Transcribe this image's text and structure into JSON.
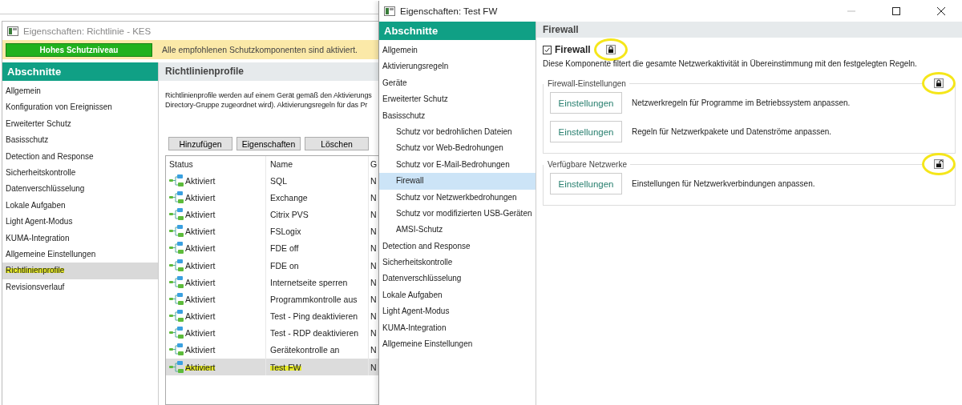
{
  "back_window": {
    "title": "Eigenschaften: Richtlinie - KES",
    "protection_level": {
      "label": "Hohes Schutzniveau",
      "message": "Alle empfohlenen Schutzkomponenten sind aktiviert."
    },
    "sidebar": {
      "header": "Abschnitte",
      "items": [
        {
          "label": "Allgemein",
          "selected": false,
          "highlighted": false
        },
        {
          "label": "Konfiguration von Ereignissen",
          "selected": false,
          "highlighted": false
        },
        {
          "label": "Erweiterter Schutz",
          "selected": false,
          "highlighted": false
        },
        {
          "label": "Basisschutz",
          "selected": false,
          "highlighted": false
        },
        {
          "label": "Detection and Response",
          "selected": false,
          "highlighted": false
        },
        {
          "label": "Sicherheitskontrolle",
          "selected": false,
          "highlighted": false
        },
        {
          "label": "Datenverschlüsselung",
          "selected": false,
          "highlighted": false
        },
        {
          "label": "Lokale Aufgaben",
          "selected": false,
          "highlighted": false
        },
        {
          "label": "Light Agent-Modus",
          "selected": false,
          "highlighted": false
        },
        {
          "label": "KUMA-Integration",
          "selected": false,
          "highlighted": false
        },
        {
          "label": "Allgemeine Einstellungen",
          "selected": false,
          "highlighted": false
        },
        {
          "label": "Richtlinienprofile",
          "selected": true,
          "highlighted": true
        },
        {
          "label": "Revisionsverlauf",
          "selected": false,
          "highlighted": false
        }
      ]
    },
    "panel": {
      "header": "Richtlinienprofile",
      "description": [
        "Richtlinienprofile werden auf einem Gerät gemäß den Aktivierungs",
        "Directory-Gruppe zugeordnet wird). Aktivierungsregeln für das Pr"
      ],
      "buttons": [
        "Hinzufügen",
        "Eigenschaften",
        "Löschen"
      ],
      "table": {
        "columns": [
          "Status",
          "Name",
          "G"
        ],
        "rows": [
          {
            "status": "Aktiviert",
            "name": "SQL",
            "column_3": "N",
            "selected": false,
            "highlighted": false
          },
          {
            "status": "Aktiviert",
            "name": "Exchange",
            "column_3": "N",
            "selected": false,
            "highlighted": false
          },
          {
            "status": "Aktiviert",
            "name": "Citrix PVS",
            "column_3": "N",
            "selected": false,
            "highlighted": false
          },
          {
            "status": "Aktiviert",
            "name": "FSLogix",
            "column_3": "N",
            "selected": false,
            "highlighted": false
          },
          {
            "status": "Aktiviert",
            "name": "FDE off",
            "column_3": "N",
            "selected": false,
            "highlighted": false
          },
          {
            "status": "Aktiviert",
            "name": "FDE on",
            "column_3": "N",
            "selected": false,
            "highlighted": false
          },
          {
            "status": "Aktiviert",
            "name": "Internetseite sperren",
            "column_3": "N",
            "selected": false,
            "highlighted": false
          },
          {
            "status": "Aktiviert",
            "name": "Programmkontrolle aus",
            "column_3": "N",
            "selected": false,
            "highlighted": false
          },
          {
            "status": "Aktiviert",
            "name": "Test - Ping deaktivieren",
            "column_3": "N",
            "selected": false,
            "highlighted": false
          },
          {
            "status": "Aktiviert",
            "name": "Test - RDP deaktivieren",
            "column_3": "N",
            "selected": false,
            "highlighted": false
          },
          {
            "status": "Aktiviert",
            "name": "Gerätekontrolle an",
            "column_3": "N",
            "selected": false,
            "highlighted": false
          },
          {
            "status": "Aktiviert",
            "name": "Test FW",
            "column_3": "N",
            "selected": true,
            "highlighted": true
          }
        ]
      }
    }
  },
  "front_window": {
    "title": "Eigenschaften: Test FW",
    "sidebar": {
      "header": "Abschnitte",
      "items": [
        {
          "label": "Allgemein",
          "selected": false
        },
        {
          "label": "Aktivierungsregeln",
          "selected": false
        },
        {
          "label": "Geräte",
          "selected": false
        },
        {
          "label": "Erweiterter Schutz",
          "selected": false
        },
        {
          "label": "Basisschutz",
          "selected": false,
          "children": [
            {
              "label": "Schutz vor bedrohlichen Dateien",
              "selected": false
            },
            {
              "label": "Schutz vor Web-Bedrohungen",
              "selected": false
            },
            {
              "label": "Schutz vor E-Mail-Bedrohungen",
              "selected": false
            },
            {
              "label": "Firewall",
              "selected": true
            },
            {
              "label": "Schutz vor Netzwerkbedrohungen",
              "selected": false
            },
            {
              "label": "Schutz vor modifizierten USB-Geräten",
              "selected": false
            },
            {
              "label": "AMSI-Schutz",
              "selected": false
            }
          ]
        },
        {
          "label": "Detection and Response",
          "selected": false
        },
        {
          "label": "Sicherheitskontrolle",
          "selected": false
        },
        {
          "label": "Datenverschlüsselung",
          "selected": false
        },
        {
          "label": "Lokale Aufgaben",
          "selected": false
        },
        {
          "label": "Light Agent-Modus",
          "selected": false
        },
        {
          "label": "KUMA-Integration",
          "selected": false
        },
        {
          "label": "Allgemeine Einstellungen",
          "selected": false
        }
      ]
    },
    "content": {
      "header": "Firewall",
      "component": {
        "label": "Firewall",
        "checked": true,
        "locked": true,
        "circled": true,
        "description": "Diese Komponente filtert die gesamte Netzwerkaktivität in Übereinstimmung mit den festgelegten Regeln."
      },
      "groups": [
        {
          "title": "Firewall-Einstellungen",
          "locked": true,
          "circled": true,
          "rows": [
            {
              "button": "Einstellungen",
              "text": "Netzwerkregeln für Programme im Betriebssystem anpassen."
            },
            {
              "button": "Einstellungen",
              "text": "Regeln für Netzwerkpakete und Datenströme anpassen."
            }
          ]
        },
        {
          "title": "Verfügbare Netzwerke",
          "locked": false,
          "circled": true,
          "rows": [
            {
              "button": "Einstellungen",
              "text": "Einstellungen für Netzwerkverbindungen anpassen."
            }
          ]
        }
      ]
    }
  }
}
